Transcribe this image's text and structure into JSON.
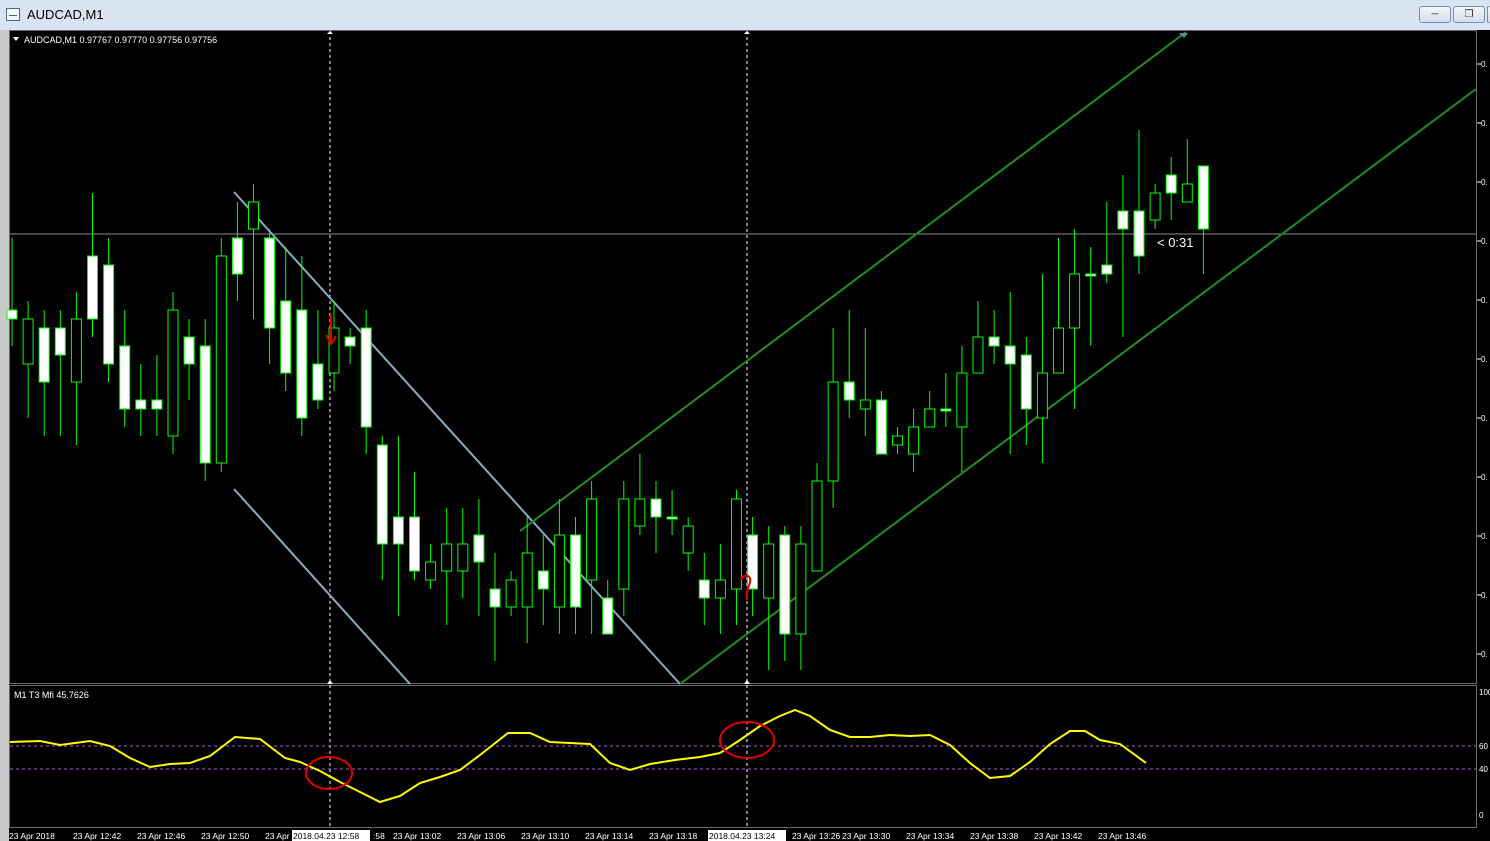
{
  "window": {
    "title": "AUDCAD,M1",
    "buttons": [
      "minimize",
      "restore",
      "close"
    ]
  },
  "chart_info": {
    "symbol_line": "AUDCAD,M1  0.97767 0.97770 0.97756 0.97756",
    "countdown": "< 0:31"
  },
  "indicator": {
    "label": "M1  T3 Mfi  45.7626",
    "levels": [
      "100",
      "60",
      "40",
      "0"
    ]
  },
  "price_scale_labels": [
    "0.",
    "0.",
    "0.",
    "0.",
    "0.",
    "0.",
    "0.",
    "0.",
    "0.",
    "0.",
    "0."
  ],
  "time_labels": [
    "23 Apr 2018",
    "23 Apr 12:42",
    "23 Apr 12:46",
    "23 Apr 12:50",
    "23 Apr",
    "2018.04.23 12:58",
    ":58",
    "23 Apr 13:02",
    "23 Apr 13:06",
    "23 Apr 13:10",
    "23 Apr 13:14",
    "23 Apr 13:18",
    "2018.04.23 13:24",
    "23 Apr 13:26",
    "23 Apr 13:30",
    "23 Apr 13:34",
    "23 Apr 13:38",
    "23 Apr 13:42",
    "23 Apr 13:46"
  ],
  "chart_data": {
    "type": "candlestick",
    "title": "AUDCAD,M1",
    "candles_note": "shape-read",
    "candles": [
      {
        "o": 3.0,
        "c": 3.1,
        "h": 2.2,
        "l": 3.4
      },
      {
        "o": 3.6,
        "c": 3.1,
        "h": 2.9,
        "l": 4.2
      },
      {
        "o": 3.2,
        "c": 3.8,
        "h": 3.0,
        "l": 4.4
      },
      {
        "o": 3.2,
        "c": 3.5,
        "h": 3.0,
        "l": 4.4
      },
      {
        "o": 3.8,
        "c": 3.1,
        "h": 2.8,
        "l": 4.5
      },
      {
        "o": 2.4,
        "c": 3.1,
        "h": 1.7,
        "l": 3.3
      },
      {
        "o": 2.5,
        "c": 3.6,
        "h": 2.2,
        "l": 3.8
      },
      {
        "o": 3.4,
        "c": 4.1,
        "h": 3.0,
        "l": 4.3
      },
      {
        "o": 4.0,
        "c": 4.1,
        "h": 3.6,
        "l": 4.4
      },
      {
        "o": 4.0,
        "c": 4.1,
        "h": 3.5,
        "l": 4.4
      },
      {
        "o": 4.4,
        "c": 3.0,
        "h": 2.8,
        "l": 4.6
      },
      {
        "o": 3.3,
        "c": 3.6,
        "h": 3.1,
        "l": 4.0
      },
      {
        "o": 3.4,
        "c": 4.7,
        "h": 3.1,
        "l": 4.9
      },
      {
        "o": 4.7,
        "c": 2.4,
        "h": 2.2,
        "l": 4.8
      },
      {
        "o": 2.2,
        "c": 2.6,
        "h": 1.8,
        "l": 2.9
      },
      {
        "o": 2.1,
        "c": 1.8,
        "h": 1.6,
        "l": 3.1
      },
      {
        "o": 2.2,
        "c": 3.2,
        "h": 2.1,
        "l": 3.6
      },
      {
        "o": 2.9,
        "c": 3.7,
        "h": 2.3,
        "l": 3.9
      },
      {
        "o": 3.0,
        "c": 4.2,
        "h": 2.4,
        "l": 4.4
      },
      {
        "o": 3.6,
        "c": 4.0,
        "h": 3.0,
        "l": 4.1
      },
      {
        "o": 3.7,
        "c": 3.2,
        "h": 2.9,
        "l": 3.9
      },
      {
        "o": 3.3,
        "c": 3.4,
        "h": 3.2,
        "l": 3.6
      },
      {
        "o": 3.2,
        "c": 4.3,
        "h": 3.0,
        "l": 4.6
      },
      {
        "o": 4.5,
        "c": 5.6,
        "h": 4.4,
        "l": 6.0
      },
      {
        "o": 5.3,
        "c": 5.6,
        "h": 4.4,
        "l": 6.4
      },
      {
        "o": 5.3,
        "c": 5.9,
        "h": 4.8,
        "l": 6.0
      },
      {
        "o": 6.0,
        "c": 5.8,
        "h": 5.6,
        "l": 6.1
      },
      {
        "o": 5.9,
        "c": 5.6,
        "h": 5.2,
        "l": 6.5
      },
      {
        "o": 5.9,
        "c": 5.6,
        "h": 5.2,
        "l": 6.2
      },
      {
        "o": 5.5,
        "c": 5.8,
        "h": 5.1,
        "l": 6.4
      },
      {
        "o": 6.1,
        "c": 6.3,
        "h": 5.7,
        "l": 6.9
      },
      {
        "o": 6.3,
        "c": 6.0,
        "h": 5.9,
        "l": 6.4
      },
      {
        "o": 6.3,
        "c": 5.7,
        "h": 5.3,
        "l": 6.7
      },
      {
        "o": 5.9,
        "c": 6.1,
        "h": 5.5,
        "l": 6.5
      },
      {
        "o": 6.3,
        "c": 5.5,
        "h": 5.1,
        "l": 6.6
      },
      {
        "o": 5.5,
        "c": 6.3,
        "h": 5.3,
        "l": 6.6
      },
      {
        "o": 6.0,
        "c": 5.1,
        "h": 4.9,
        "l": 6.6
      },
      {
        "o": 6.2,
        "c": 6.6,
        "h": 6.0,
        "l": 6.6
      },
      {
        "o": 6.1,
        "c": 5.1,
        "h": 4.9,
        "l": 6.4
      },
      {
        "o": 5.4,
        "c": 5.1,
        "h": 4.6,
        "l": 5.5
      },
      {
        "o": 5.1,
        "c": 5.3,
        "h": 4.9,
        "l": 5.7
      },
      {
        "o": 5.3,
        "c": 5.3,
        "h": 5.0,
        "l": 5.5
      },
      {
        "o": 5.7,
        "c": 5.4,
        "h": 5.3,
        "l": 5.9
      },
      {
        "o": 6.0,
        "c": 6.2,
        "h": 5.7,
        "l": 6.5
      },
      {
        "o": 6.2,
        "c": 6.0,
        "h": 5.6,
        "l": 6.6
      },
      {
        "o": 6.1,
        "c": 5.1,
        "h": 5.0,
        "l": 6.5
      },
      {
        "o": 5.5,
        "c": 6.1,
        "h": 5.3,
        "l": 6.4
      },
      {
        "o": 6.2,
        "c": 5.6,
        "h": 5.4,
        "l": 7.0
      },
      {
        "o": 5.5,
        "c": 6.6,
        "h": 5.4,
        "l": 6.9
      },
      {
        "o": 6.6,
        "c": 5.6,
        "h": 5.4,
        "l": 7.0
      },
      {
        "o": 5.9,
        "c": 4.9,
        "h": 4.7,
        "l": 5.8
      },
      {
        "o": 4.9,
        "c": 3.8,
        "h": 3.2,
        "l": 5.2
      },
      {
        "o": 3.8,
        "c": 4.0,
        "h": 3.0,
        "l": 4.2
      },
      {
        "o": 4.1,
        "c": 4.0,
        "h": 3.2,
        "l": 4.4
      },
      {
        "o": 4.0,
        "c": 4.6,
        "h": 3.9,
        "l": 4.6
      },
      {
        "o": 4.5,
        "c": 4.4,
        "h": 4.3,
        "l": 4.6
      },
      {
        "o": 4.6,
        "c": 4.3,
        "h": 4.1,
        "l": 4.8
      },
      {
        "o": 4.3,
        "c": 4.1,
        "h": 3.9,
        "l": 4.3
      },
      {
        "o": 4.1,
        "c": 4.1,
        "h": 3.7,
        "l": 4.3
      },
      {
        "o": 4.3,
        "c": 3.7,
        "h": 3.4,
        "l": 4.8
      },
      {
        "o": 3.7,
        "c": 3.3,
        "h": 2.9,
        "l": 3.7
      },
      {
        "o": 3.3,
        "c": 3.4,
        "h": 3.0,
        "l": 3.6
      },
      {
        "o": 3.4,
        "c": 3.6,
        "h": 2.8,
        "l": 4.6
      },
      {
        "o": 3.5,
        "c": 4.1,
        "h": 3.3,
        "l": 4.5
      },
      {
        "o": 4.2,
        "c": 3.7,
        "h": 2.6,
        "l": 4.7
      },
      {
        "o": 3.7,
        "c": 3.2,
        "h": 2.2,
        "l": 3.7
      },
      {
        "o": 3.2,
        "c": 2.6,
        "h": 2.1,
        "l": 4.1
      },
      {
        "o": 2.6,
        "c": 2.6,
        "h": 2.3,
        "l": 3.4
      },
      {
        "o": 2.5,
        "c": 2.6,
        "h": 1.8,
        "l": 2.7
      },
      {
        "o": 1.9,
        "c": 2.1,
        "h": 1.5,
        "l": 3.3
      },
      {
        "o": 1.9,
        "c": 2.4,
        "h": 1.0,
        "l": 2.6
      },
      {
        "o": 2.0,
        "c": 1.7,
        "h": 1.6,
        "l": 2.1
      },
      {
        "o": 1.5,
        "c": 1.7,
        "h": 1.3,
        "l": 2.0
      },
      {
        "o": 1.8,
        "c": 1.6,
        "h": 1.1,
        "l": 1.8
      },
      {
        "o": 1.4,
        "c": 2.1,
        "h": 1.5,
        "l": 2.6
      }
    ]
  }
}
